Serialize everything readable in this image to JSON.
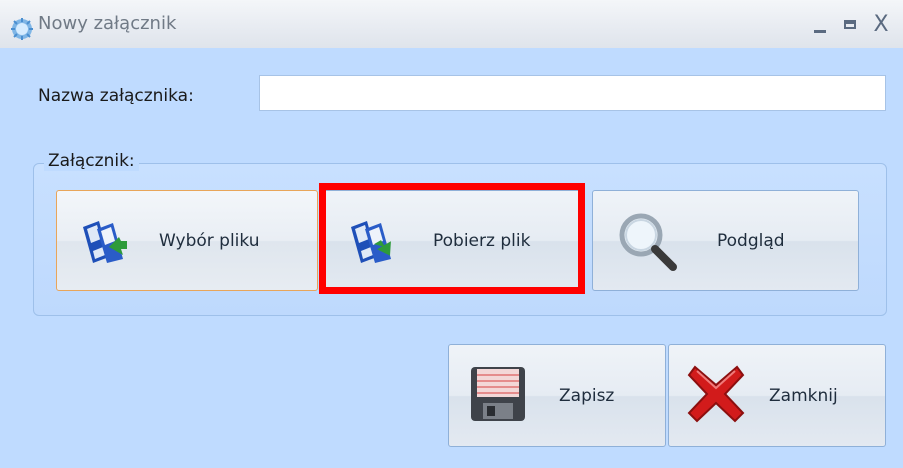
{
  "window": {
    "title": "Nowy załącznik",
    "controls": {
      "minimize": "_",
      "close": "X"
    }
  },
  "form": {
    "name_label": "Nazwa załącznika:",
    "name_value": "",
    "group_label": "Załącznik:"
  },
  "buttons": {
    "choose_file": "Wybór pliku",
    "download_file": "Pobierz plik",
    "preview": "Podgląd",
    "save": "Zapisz",
    "close": "Zamknij"
  },
  "colors": {
    "window_bg": "#bfdbff",
    "highlight": "#ff0000",
    "focus_border": "#e8a55a"
  },
  "icons": {
    "app": "app-gear-icon",
    "choose_file": "floppy-arrow-icon",
    "download_file": "floppy-download-icon",
    "preview": "magnifier-icon",
    "save": "floppy-disk-icon",
    "close": "red-x-icon"
  }
}
